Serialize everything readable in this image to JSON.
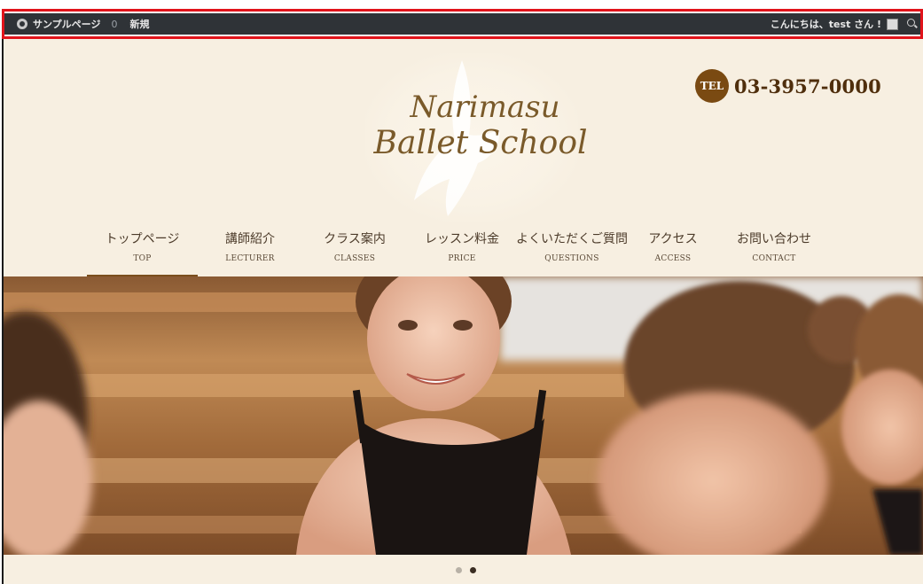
{
  "adminbar": {
    "site_name": "サンプルページ",
    "comments_count": "0",
    "new_label": "新規",
    "greeting": "こんにちは、test さん !"
  },
  "header": {
    "logo_line1": "Narimasu",
    "logo_line2": "Ballet School",
    "tel_badge": "TEL",
    "tel_number": "03-3957-0000"
  },
  "nav": {
    "items": [
      {
        "jp": "トップページ",
        "en": "TOP"
      },
      {
        "jp": "講師紹介",
        "en": "LECTURER"
      },
      {
        "jp": "クラス案内",
        "en": "CLASSES"
      },
      {
        "jp": "レッスン料金",
        "en": "PRICE"
      },
      {
        "jp": "よくいただくご質問",
        "en": "QUESTIONS"
      },
      {
        "jp": "アクセス",
        "en": "ACCESS"
      },
      {
        "jp": "お問い合わせ",
        "en": "CONTACT"
      }
    ],
    "active_index": 0
  },
  "slider": {
    "dot_count": 2,
    "active_dot": 1
  },
  "colors": {
    "adminbar_bg": "#2f3337",
    "highlight_outline": "#e1141b",
    "header_bg": "#f7efe1",
    "brand_brown": "#7a4a12",
    "nav_active_underline": "#7a4e1c"
  }
}
